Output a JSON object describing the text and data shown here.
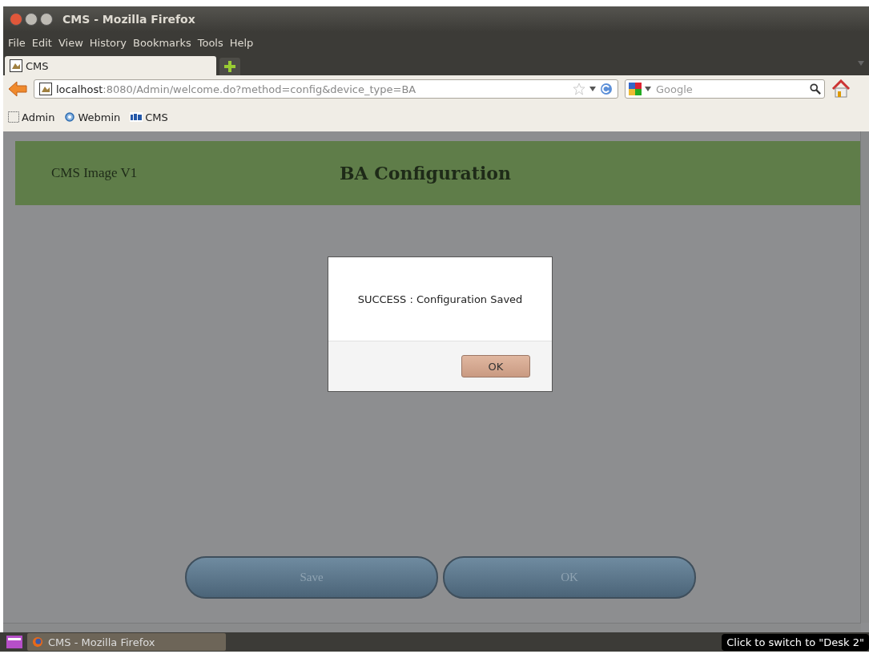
{
  "window": {
    "title": "CMS - Mozilla Firefox"
  },
  "menu": [
    "File",
    "Edit",
    "View",
    "History",
    "Bookmarks",
    "Tools",
    "Help"
  ],
  "tabs": [
    {
      "label": "CMS",
      "selected": true
    }
  ],
  "address_bar": {
    "host": "localhost",
    "path": ":8080/Admin/welcome.do?method=config&device_type=BA"
  },
  "search": {
    "placeholder": "Google"
  },
  "bookmarks": [
    {
      "label": "Admin",
      "kind": "blank"
    },
    {
      "label": "Webmin",
      "kind": "webmin"
    },
    {
      "label": "CMS",
      "kind": "cms"
    }
  ],
  "page": {
    "brand": "CMS Image V1",
    "heading": "BA Configuration",
    "buttons": [
      {
        "label": "Save",
        "disabled": true
      },
      {
        "label": "OK",
        "disabled": true
      }
    ]
  },
  "dialog": {
    "message": "SUCCESS : Configuration Saved",
    "button": "OK"
  },
  "taskbar": {
    "items": [
      {
        "label": "CMS - Mozilla Firefox",
        "selected": true
      }
    ],
    "tooltip": "Click to switch to \"Desk 2\""
  }
}
